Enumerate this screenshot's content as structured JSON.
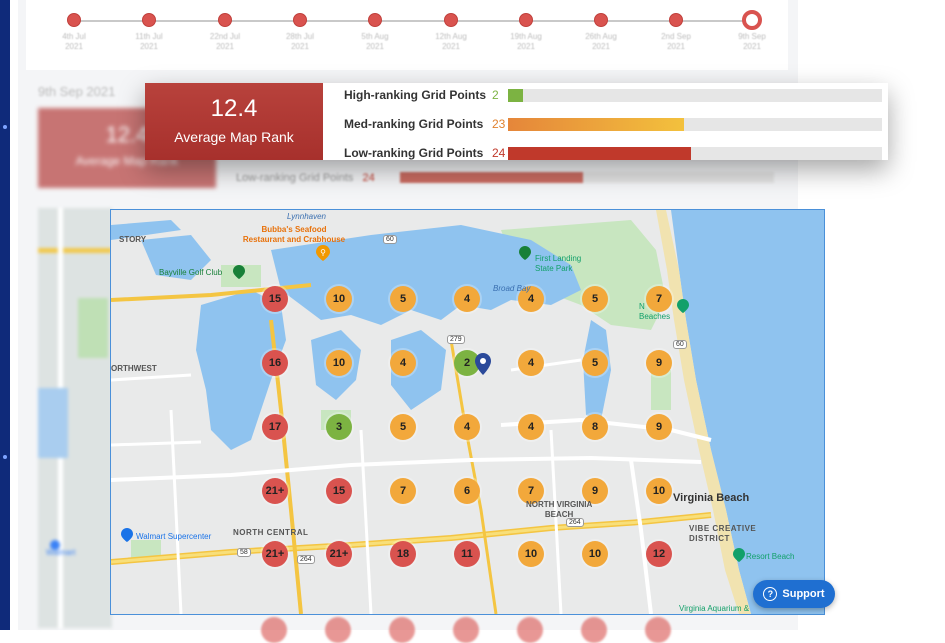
{
  "timeline": {
    "dates": [
      "4th Jul 2021",
      "11th Jul 2021",
      "22nd Jul 2021",
      "28th Jul 2021",
      "5th Aug 2021",
      "12th Aug 2021",
      "19th Aug 2021",
      "26th Aug 2021",
      "2nd Sep 2021",
      "9th Sep 2021"
    ],
    "selected_index": 9
  },
  "background": {
    "date": "9th Sep 2021",
    "rank_value": "12.4",
    "rank_label": "Average Map Rank",
    "low_label": "Low-ranking Grid Points",
    "low_count": "24"
  },
  "stats": {
    "avg_rank": "12.4",
    "avg_rank_label": "Average Map Rank",
    "rows": [
      {
        "label": "High-ranking Grid Points",
        "count": "2",
        "fraction": 0.04,
        "color": "#7cb342"
      },
      {
        "label": "Med-ranking Grid Points",
        "count": "23",
        "fraction": 0.47,
        "color": "#f0a63a"
      },
      {
        "label": "Low-ranking Grid Points",
        "count": "24",
        "fraction": 0.49,
        "color": "#c0392b"
      }
    ]
  },
  "map": {
    "grid": [
      [
        "15",
        "10",
        "5",
        "4",
        "4",
        "5",
        "7"
      ],
      [
        "16",
        "10",
        "4",
        "2",
        "4",
        "5",
        "9"
      ],
      [
        "17",
        "3",
        "5",
        "4",
        "4",
        "8",
        "9"
      ],
      [
        "21+",
        "15",
        "7",
        "6",
        "7",
        "9",
        "10"
      ],
      [
        "21+",
        "21+",
        "18",
        "11",
        "10",
        "10",
        "12"
      ]
    ],
    "places": {
      "bubbas": "Bubba's Seafood\nRestaurant and Crabhouse",
      "bayville": "Bayville Golf Club",
      "first_landing": "First Landing\nState Park",
      "walmart": "Walmart Supercenter",
      "resort": "Resort Beach",
      "north_central": "NORTH CENTRAL",
      "vibe": "VIBE CREATIVE\nDISTRICT",
      "va_aquarium": "Virginia Aquarium &",
      "north_va_beach": "NORTH VIRGINIA\nBEACH",
      "virginia_beach": "Virginia Beach",
      "northwest": "ORTHWEST",
      "story": "STORY",
      "lynnhaven": "Lynnhaven",
      "beaches": "N\nBeaches",
      "broad_bay": "Broad Bay"
    }
  },
  "support_label": "Support"
}
